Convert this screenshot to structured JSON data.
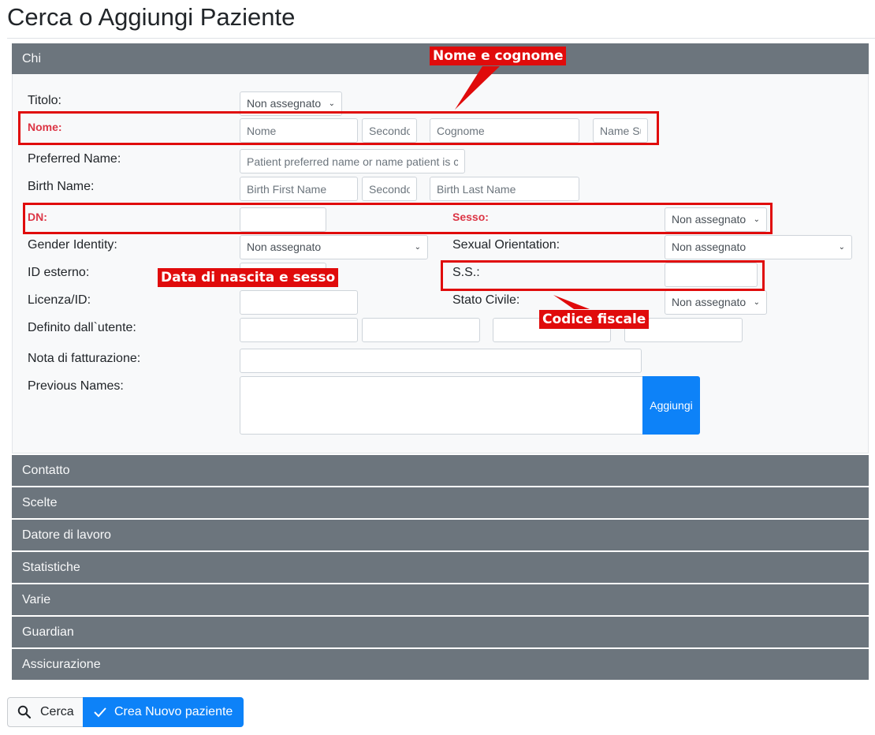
{
  "page": {
    "title": "Cerca o Aggiungi Paziente"
  },
  "sections": {
    "chi": "Chi",
    "contatto": "Contatto",
    "scelte": "Scelte",
    "datore": "Datore di lavoro",
    "statistiche": "Statistiche",
    "varie": "Varie",
    "guardian": "Guardian",
    "assicurazione": "Assicurazione"
  },
  "form": {
    "titolo": {
      "label": "Titolo:",
      "value": "Non assegnato"
    },
    "nome": {
      "label": "Nome:",
      "first_placeholder": "Nome",
      "middle_placeholder": "Secondo",
      "last_placeholder": "Cognome",
      "suffix_placeholder": "Name Suffix"
    },
    "preferred_name": {
      "label": "Preferred Name:",
      "placeholder": "Patient preferred name or name patient is commonly known"
    },
    "birth_name": {
      "label": "Birth Name:",
      "first_placeholder": "Birth First Name",
      "middle_placeholder": "Secondo",
      "last_placeholder": "Birth Last Name"
    },
    "dn": {
      "label": "DN:"
    },
    "sesso": {
      "label": "Sesso:",
      "value": "Non assegnato"
    },
    "gender_identity": {
      "label": "Gender Identity:",
      "value": "Non assegnato"
    },
    "sexual_orientation": {
      "label": "Sexual Orientation:",
      "value": "Non assegnato"
    },
    "id_esterno": {
      "label": "ID esterno:"
    },
    "ss": {
      "label": "S.S.:"
    },
    "licenza": {
      "label": "Licenza/ID:"
    },
    "stato_civile": {
      "label": "Stato Civile:",
      "value": "Non assegnato"
    },
    "definito_utente": {
      "label": "Definito dall`utente:"
    },
    "nota_fatturazione": {
      "label": "Nota di fatturazione:"
    },
    "previous_names": {
      "label": "Previous Names:",
      "add_button": "Aggiungi"
    }
  },
  "annotations": {
    "nome_cognome": "Nome e cognome",
    "data_nascita_sesso": "Data di nascita e sesso",
    "codice_fiscale": "Codice fiscale"
  },
  "actions": {
    "search": "Cerca",
    "create": "Crea Nuovo paziente"
  },
  "colors": {
    "annotation": "#e00b0b",
    "section_header": "#6c757d",
    "primary": "#0d82f8",
    "required_label": "#dc3545"
  },
  "icons": {
    "search": "search-icon",
    "check": "check-icon",
    "select": "chevron-down-icon"
  }
}
